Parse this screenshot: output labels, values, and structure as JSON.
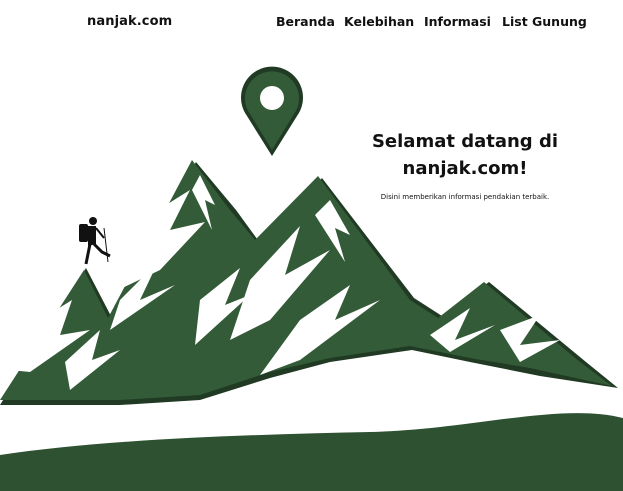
{
  "brand": {
    "logo_text": "nanjak.com"
  },
  "nav": {
    "items": [
      {
        "label": "Beranda"
      },
      {
        "label": "Kelebihan"
      },
      {
        "label": "Informasi"
      },
      {
        "label": "List Gunung"
      }
    ]
  },
  "hero": {
    "title_line1": "Selamat datang di",
    "title_line2": "nanjak.com!",
    "subtitle": "Disini memberikan informasi pendakian terbaik."
  },
  "colors": {
    "mountain_light": "#335b38",
    "mountain_dark": "#203a23",
    "ground": "#2e5132"
  },
  "icons": {
    "pin": "location-pin-icon",
    "hiker": "hiker-icon"
  }
}
